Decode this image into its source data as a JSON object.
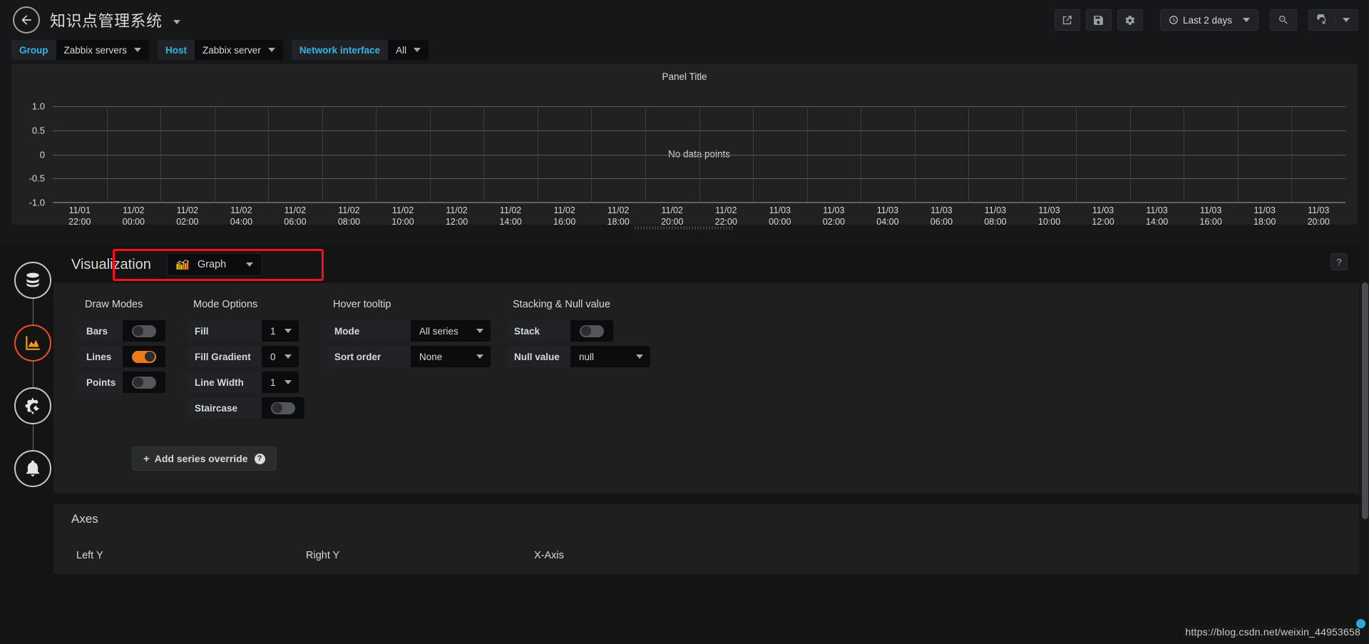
{
  "navbar": {
    "back_icon": "arrow-left-circle-icon",
    "dashboard_title": "知识点管理系统",
    "buttons": [
      {
        "name": "share-dashboard-button",
        "icon": "share-icon"
      },
      {
        "name": "save-dashboard-button",
        "icon": "save-floppy-icon"
      },
      {
        "name": "dashboard-settings-button",
        "icon": "gear-icon"
      }
    ],
    "time_picker": {
      "icon": "clock-icon",
      "label": "Last 2 days"
    },
    "zoom_out_icon": "magnifier-minus-icon",
    "refresh_icon": "refresh-icon"
  },
  "submenu": {
    "variables": [
      {
        "label": "Group",
        "value": "Zabbix servers"
      },
      {
        "label": "Host",
        "value": "Zabbix server"
      },
      {
        "label": "Network interface",
        "value": "All"
      }
    ]
  },
  "panel": {
    "title": "Panel Title",
    "no_data_text": "No data points"
  },
  "chart_data": {
    "type": "line",
    "title": "Panel Title",
    "xlabel": "",
    "ylabel": "",
    "ylim": [
      -1.0,
      1.0
    ],
    "y_ticks": [
      "1.0",
      "0.5",
      "0",
      "-0.5",
      "-1.0"
    ],
    "y_values": [
      1.0,
      0.5,
      0,
      -0.5,
      -1.0
    ],
    "x_ticks": [
      {
        "date": "11/01",
        "time": "22:00"
      },
      {
        "date": "11/02",
        "time": "00:00"
      },
      {
        "date": "11/02",
        "time": "02:00"
      },
      {
        "date": "11/02",
        "time": "04:00"
      },
      {
        "date": "11/02",
        "time": "06:00"
      },
      {
        "date": "11/02",
        "time": "08:00"
      },
      {
        "date": "11/02",
        "time": "10:00"
      },
      {
        "date": "11/02",
        "time": "12:00"
      },
      {
        "date": "11/02",
        "time": "14:00"
      },
      {
        "date": "11/02",
        "time": "16:00"
      },
      {
        "date": "11/02",
        "time": "18:00"
      },
      {
        "date": "11/02",
        "time": "20:00"
      },
      {
        "date": "11/02",
        "time": "22:00"
      },
      {
        "date": "11/03",
        "time": "00:00"
      },
      {
        "date": "11/03",
        "time": "02:00"
      },
      {
        "date": "11/03",
        "time": "04:00"
      },
      {
        "date": "11/03",
        "time": "06:00"
      },
      {
        "date": "11/03",
        "time": "08:00"
      },
      {
        "date": "11/03",
        "time": "10:00"
      },
      {
        "date": "11/03",
        "time": "12:00"
      },
      {
        "date": "11/03",
        "time": "14:00"
      },
      {
        "date": "11/03",
        "time": "16:00"
      },
      {
        "date": "11/03",
        "time": "18:00"
      },
      {
        "date": "11/03",
        "time": "20:00"
      }
    ],
    "series": [],
    "grid": true,
    "legend": false,
    "annotation": "No data points"
  },
  "rail": {
    "items": [
      {
        "name": "sidebar-tab-queries",
        "icon": "database-icon",
        "active": false
      },
      {
        "name": "sidebar-tab-visualization",
        "icon": "area-chart-icon",
        "active": true
      },
      {
        "name": "sidebar-tab-general",
        "icon": "gear-wrench-icon",
        "active": false
      },
      {
        "name": "sidebar-tab-alert",
        "icon": "bell-icon",
        "active": false
      }
    ]
  },
  "visualization": {
    "label": "Visualization",
    "selected": "Graph",
    "select_icon": "bar-chart-icon",
    "help_label": "?",
    "highlight_color": "#fc0d1b"
  },
  "options": {
    "draw_modes": {
      "title": "Draw Modes",
      "rows": [
        {
          "label": "Bars",
          "toggle": "off"
        },
        {
          "label": "Lines",
          "toggle": "on"
        },
        {
          "label": "Points",
          "toggle": "off"
        }
      ]
    },
    "mode_options": {
      "title": "Mode Options",
      "rows": [
        {
          "label": "Fill",
          "type": "select",
          "value": "1"
        },
        {
          "label": "Fill Gradient",
          "type": "select",
          "value": "0"
        },
        {
          "label": "Line Width",
          "type": "select",
          "value": "1"
        },
        {
          "label": "Staircase",
          "type": "toggle",
          "value": "off"
        }
      ]
    },
    "hover_tooltip": {
      "title": "Hover tooltip",
      "rows": [
        {
          "label": "Mode",
          "value": "All series"
        },
        {
          "label": "Sort order",
          "value": "None"
        }
      ]
    },
    "stacking": {
      "title": "Stacking & Null value",
      "rows": [
        {
          "label": "Stack",
          "type": "toggle",
          "value": "off"
        },
        {
          "label": "Null value",
          "type": "select",
          "value": "null"
        }
      ]
    },
    "add_series_override": {
      "plus": "+",
      "label": "Add series override",
      "help": "?"
    }
  },
  "axes": {
    "title": "Axes",
    "columns": [
      "Left Y",
      "Right Y",
      "X-Axis"
    ]
  },
  "watermark": {
    "url": "https://blog.csdn.net/weixin_44953658"
  },
  "colors": {
    "accent_orange": "#eb7b18",
    "link_cyan": "#33b5e5",
    "panel_bg": "#212124",
    "editor_bg": "#1f1f20",
    "page_bg": "#161719",
    "highlight_red": "#fc0d1b"
  }
}
